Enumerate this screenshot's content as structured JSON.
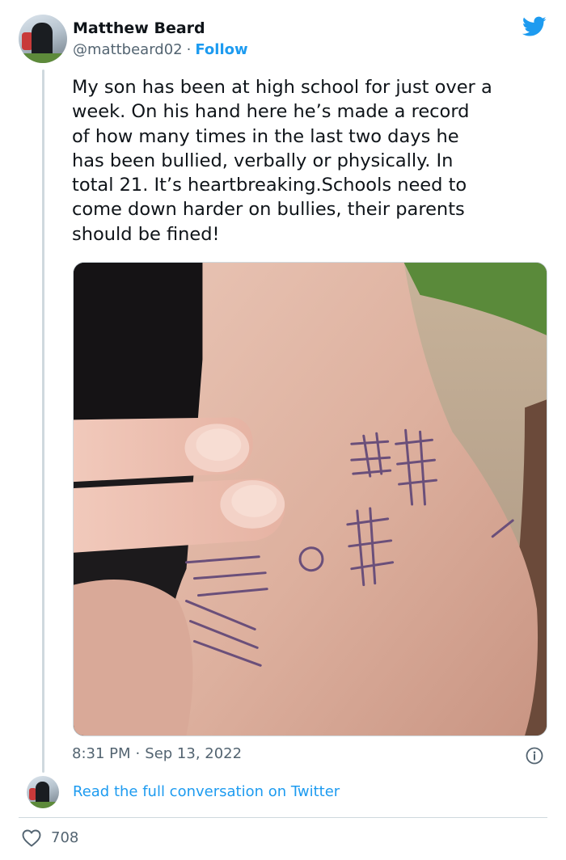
{
  "author": {
    "name": "Matthew Beard",
    "handle": "@mattbeard02",
    "separator": "·",
    "follow_label": "Follow"
  },
  "tweet": {
    "text": "My son has been at high school for just over a\nweek. On his hand here he’s made a record\nof how many times in the last two days he\nhas been bullied, verbally or physically. In\ntotal 21. It’s heartbreaking.Schools need to\ncome down harder on bullies, their parents\nshould be fined!",
    "time": "8:31 PM",
    "date_separator": "·",
    "date": "Sep 13, 2022"
  },
  "footer": {
    "read_more_label": "Read the full conversation on Twitter",
    "like_count": "708"
  },
  "icons": {
    "brand": "twitter-bird-icon",
    "info": "info-icon",
    "like": "heart-icon"
  },
  "colors": {
    "accent": "#1d9bf0",
    "text": "#0f1419",
    "secondary": "#536471",
    "border": "#cfd9de"
  }
}
